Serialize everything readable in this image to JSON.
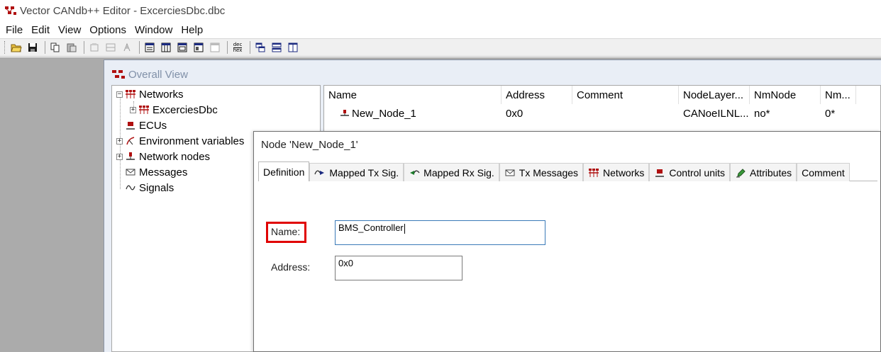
{
  "window": {
    "title": "Vector CANdb++ Editor - ExcerciesDbc.dbc"
  },
  "menu": [
    "File",
    "Edit",
    "View",
    "Options",
    "Window",
    "Help"
  ],
  "toolbar": {
    "dec_hex": {
      "top": "dec",
      "bottom": "hex"
    }
  },
  "overall_view": {
    "title": "Overall View"
  },
  "tree": {
    "networks": "Networks",
    "excercies": "ExcerciesDbc",
    "ecus": "ECUs",
    "env_vars": "Environment variables",
    "network_nodes": "Network nodes",
    "messages": "Messages",
    "signals": "Signals"
  },
  "list": {
    "columns": [
      "Name",
      "Address",
      "Comment",
      "NodeLayer...",
      "NmNode",
      "Nm..."
    ],
    "rows": [
      {
        "name": "New_Node_1",
        "address": "0x0",
        "comment": "",
        "nodelayer": "CANoeILNL...",
        "nmnode": "no*",
        "nm": "0*"
      }
    ]
  },
  "dialog": {
    "title": "Node 'New_Node_1'",
    "tabs": [
      "Definition",
      "Mapped Tx Sig.",
      "Mapped Rx Sig.",
      "Tx Messages",
      "Networks",
      "Control units",
      "Attributes",
      "Comment"
    ],
    "name_label": "Name:",
    "name_value": "BMS_Controller",
    "address_label": "Address:",
    "address_value": "0x0"
  },
  "colors": {
    "highlight": "#e00000",
    "icon_red": "#b01010",
    "mdi_background": "#ababab"
  }
}
